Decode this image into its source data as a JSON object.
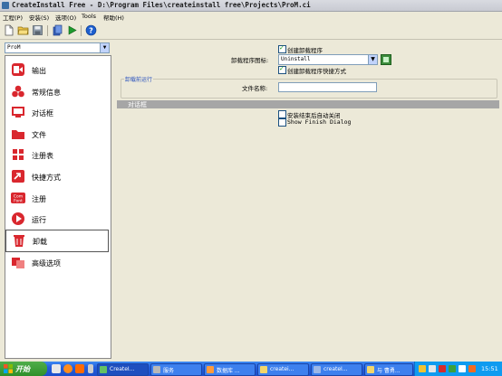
{
  "window": {
    "title": "CreateInstall Free - D:\\Program Files\\createinstall free\\Projects\\ProM.ci"
  },
  "menu": [
    {
      "label": "工程(P)"
    },
    {
      "label": "安装(S)"
    },
    {
      "label": "选项(O)"
    },
    {
      "label": "Tools"
    },
    {
      "label": "帮助(H)"
    }
  ],
  "toolbar": {
    "icons": [
      "new-file-icon",
      "open-folder-icon",
      "save-disk-icon",
      "build-icon",
      "run-icon",
      "help-icon"
    ]
  },
  "project_select": {
    "value": "ProM"
  },
  "nav": [
    {
      "label": "输出",
      "icon": "output-icon",
      "color": "#d9272e"
    },
    {
      "label": "常规信息",
      "icon": "general-info-icon",
      "color": "#d9272e"
    },
    {
      "label": "对话框",
      "icon": "dialog-icon",
      "color": "#d9272e"
    },
    {
      "label": "文件",
      "icon": "folder-icon",
      "color": "#d9272e"
    },
    {
      "label": "注册表",
      "icon": "registry-icon",
      "color": "#d9272e"
    },
    {
      "label": "快捷方式",
      "icon": "shortcut-icon",
      "color": "#d9272e"
    },
    {
      "label": "注册",
      "icon": "com-font-icon",
      "color": "#d9272e"
    },
    {
      "label": "运行",
      "icon": "run-icon",
      "color": "#d9272e"
    },
    {
      "label": "卸载",
      "icon": "uninstall-icon",
      "color": "#d9272e"
    },
    {
      "label": "高级选项",
      "icon": "advanced-icon",
      "color": "#d9272e"
    }
  ],
  "uninstall": {
    "create_uninstaller": {
      "label": "创建卸载程序",
      "checked": true
    },
    "icon_label": "卸载程序图标:",
    "icon_value": "Uninstall",
    "create_shortcut": {
      "label": "创建卸载程序快捷方式",
      "checked": true
    },
    "before_run": {
      "group_title": "卸载前运行",
      "filename_label": "文件名称:",
      "filename_value": ""
    },
    "dialogs": {
      "section_title": "对话框",
      "auto_close": {
        "label": "安装结束后自动关闭",
        "checked": false
      },
      "show_finish": {
        "label": "Show Finish Dialog",
        "checked": false
      }
    }
  },
  "taskbar": {
    "start_label": "开始",
    "tasks": [
      {
        "label": "CreateI...",
        "active": true
      },
      {
        "label": "服务",
        "active": false
      },
      {
        "label": "数据库 ...",
        "active": false
      },
      {
        "label": "createi...",
        "active": false
      },
      {
        "label": "createI...",
        "active": false
      },
      {
        "label": "与 曹勇...",
        "active": false
      }
    ],
    "clock": "15:51"
  },
  "colors": {
    "window_bg": "#ece9d8",
    "section_bar": "#a6a6a6",
    "group_title": "#2a52be",
    "taskbar": "#245edb"
  }
}
